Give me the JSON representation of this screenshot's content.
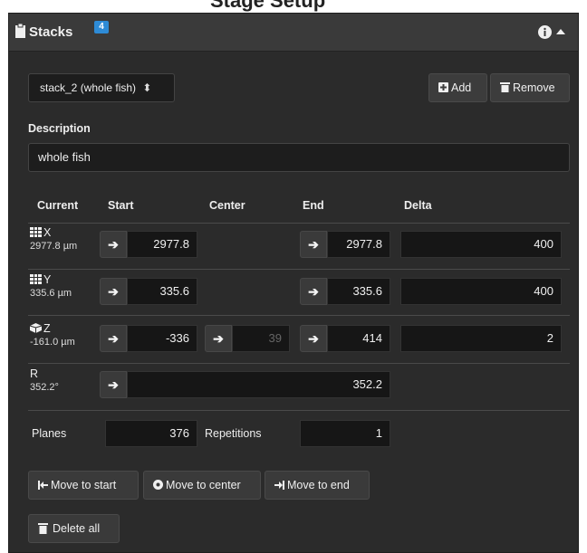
{
  "page_heading": "Stage Setup",
  "header": {
    "title": "Stacks",
    "badge": "4"
  },
  "stack_select": {
    "value": "stack_2 (whole fish)",
    "arrow": "⬍"
  },
  "buttons": {
    "add": "Add",
    "remove": "Remove",
    "move_to_start": "Move to start",
    "move_to_center": "Move to center",
    "move_to_end": "Move to end",
    "delete_all": "Delete all"
  },
  "description": {
    "label": "Description",
    "value": "whole fish"
  },
  "columns": {
    "current": "Current",
    "start": "Start",
    "center": "Center",
    "end": "End",
    "delta": "Delta"
  },
  "axes": {
    "x": {
      "name": "X",
      "current": "2977.8 µm",
      "start": "2977.8",
      "end": "2977.8",
      "delta": "400"
    },
    "y": {
      "name": "Y",
      "current": "335.6 µm",
      "start": "335.6",
      "end": "335.6",
      "delta": "400"
    },
    "z": {
      "name": "Z",
      "current": "-161.0 µm",
      "start": "-336",
      "center": "39",
      "end": "414",
      "delta": "2"
    },
    "r": {
      "name": "R",
      "current": "352.2°",
      "value": "352.2"
    }
  },
  "planes": {
    "label": "Planes",
    "value": "376"
  },
  "repetitions": {
    "label": "Repetitions",
    "value": "1"
  },
  "icons": {
    "arrow": "➔"
  }
}
